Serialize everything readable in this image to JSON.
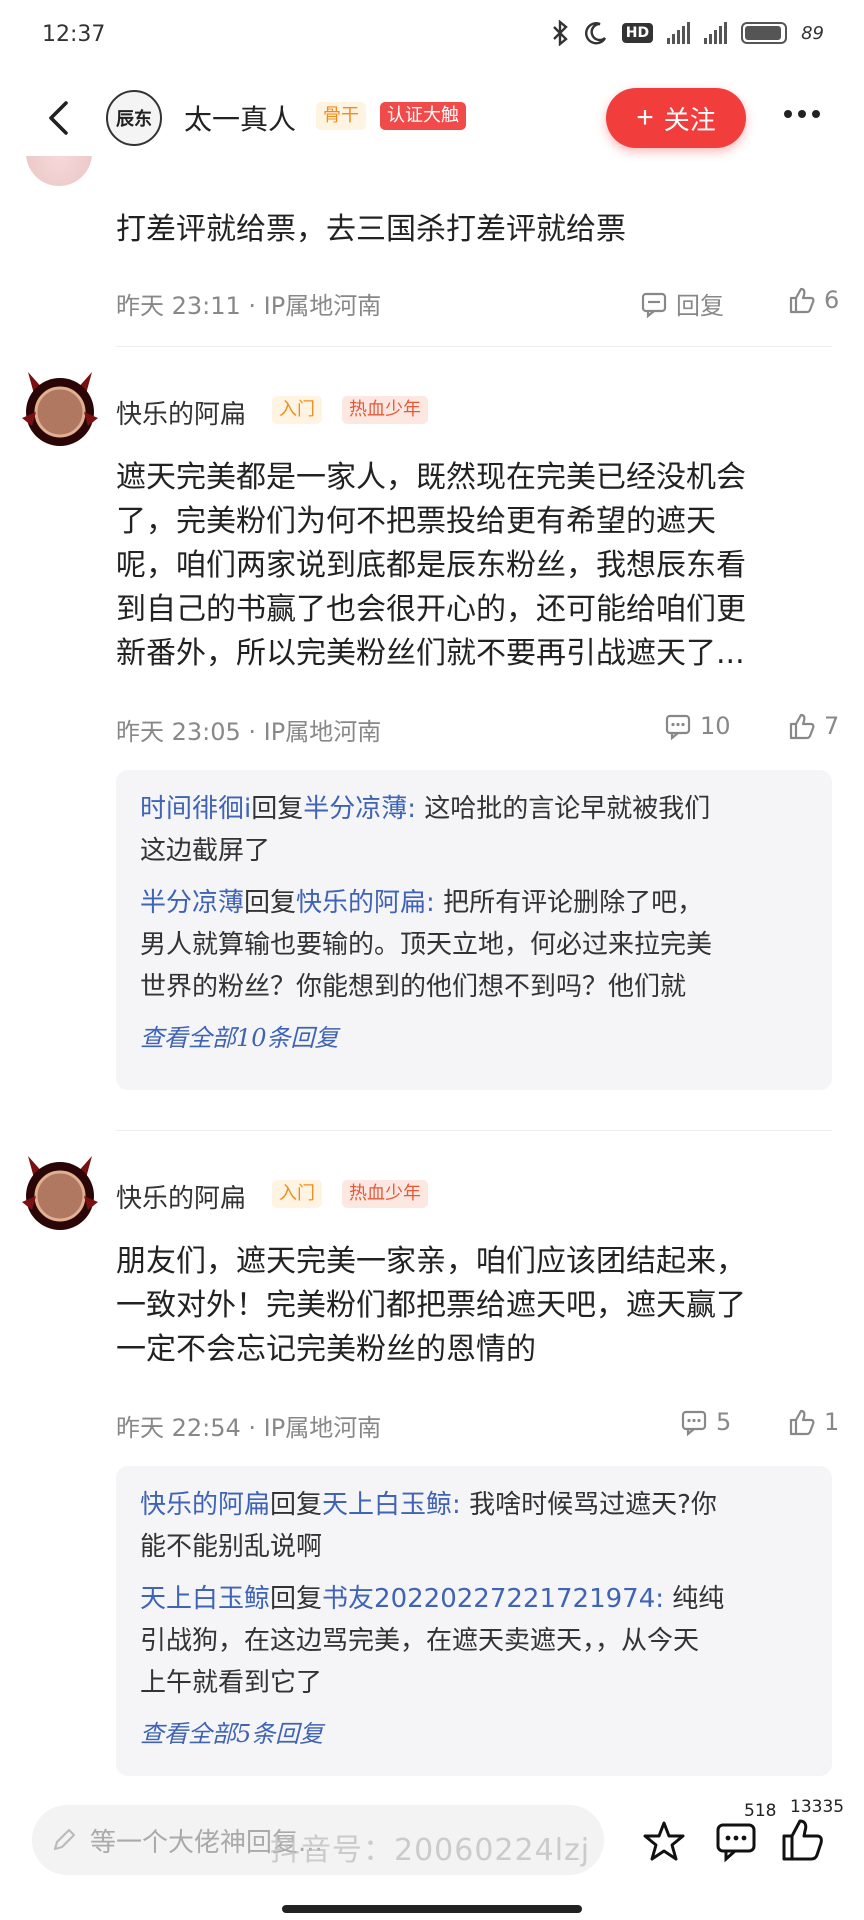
{
  "status_bar": {
    "time": "12:37",
    "hd": "HD",
    "battery": "89"
  },
  "header": {
    "avatar_text": "辰东",
    "author": "太一真人",
    "badge_level": "骨干",
    "badge_auth": "认证大触",
    "follow_label": "关注"
  },
  "comments": [
    {
      "text": "打差评就给票，去三国杀打差评就给票",
      "time_ip": "昨天 23:11 · IP属地河南",
      "reply_label": "回复",
      "likes": "6"
    },
    {
      "user": "快乐的阿扁",
      "badge_level": "入门",
      "badge_title": "热血少年",
      "text_lines": [
        "遮天完美都是一家人，既然现在完美已经没机会",
        "了，完美粉们为何不把票投给更有希望的遮天",
        "呢，咱们两家说到底都是辰东粉丝，我想辰东看",
        "到自己的书赢了也会很开心的，还可能给咱们更",
        "新番外，所以完美粉丝们就不要再引战遮天了..."
      ],
      "time_ip": "昨天 23:05 · IP属地河南",
      "comments": "10",
      "likes": "7",
      "replies": [
        {
          "from": "时间徘徊i",
          "verb": "回复",
          "to": "半分凉薄",
          "lines": [
            "这哈批的言论早就被我们",
            "这边截屏了"
          ]
        },
        {
          "from": "半分凉薄",
          "verb": "回复",
          "to": "快乐的阿扁",
          "lines": [
            "把所有评论删除了吧，",
            "男人就算输也要输的。顶天立地，何必过来拉完美",
            "世界的粉丝？你能想到的他们想不到吗？他们就"
          ]
        }
      ],
      "view_all": "查看全部10条回复"
    },
    {
      "user": "快乐的阿扁",
      "badge_level": "入门",
      "badge_title": "热血少年",
      "text_lines": [
        "朋友们，遮天完美一家亲，咱们应该团结起来，",
        "一致对外！完美粉们都把票给遮天吧，遮天赢了",
        "一定不会忘记完美粉丝的恩情的"
      ],
      "time_ip": "昨天 22:54 · IP属地河南",
      "comments": "5",
      "likes": "1",
      "replies": [
        {
          "from": "快乐的阿扁",
          "verb": "回复",
          "to": "天上白玉鲸",
          "lines": [
            "我啥时候骂过遮天?你",
            "能不能别乱说啊"
          ]
        },
        {
          "from": "天上白玉鲸",
          "verb": "回复",
          "to": "书友20220227221721974",
          "lines": [
            "纯纯",
            "引战狗，在这边骂完美，在遮天卖遮天，，从今天",
            "上午就看到它了"
          ]
        }
      ],
      "view_all": "查看全部5条回复"
    }
  ],
  "bottom_bar": {
    "placeholder": "等一个大佬神回复...",
    "comment_count": "518",
    "like_count": "13335",
    "watermark": "抖音号：20060224lzj"
  }
}
